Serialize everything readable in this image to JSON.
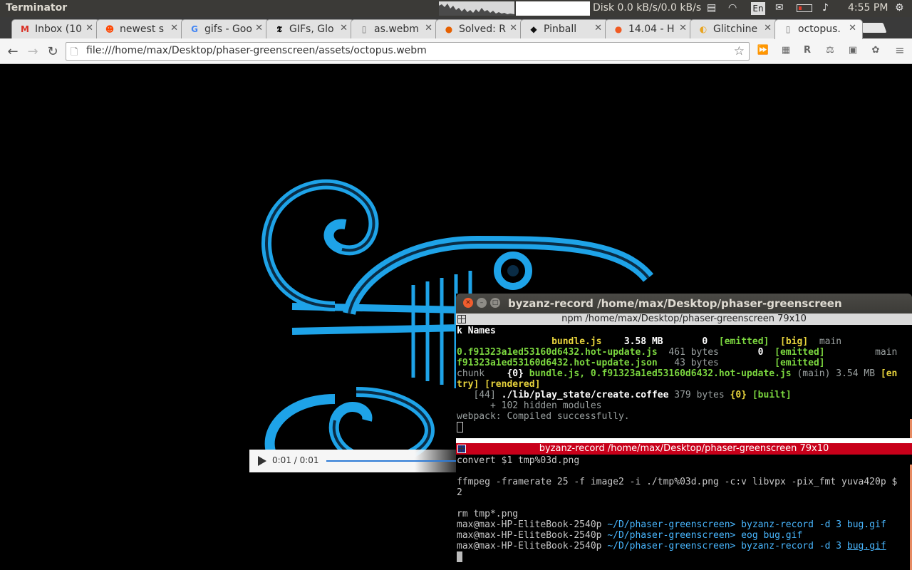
{
  "panel": {
    "app_name": "Terminator",
    "disk_label": "Disk 0.0 kB/s/0.0 kB/s",
    "lang": "En",
    "clock": "4:55 PM"
  },
  "tabs": [
    {
      "favicon": "M",
      "title": "Inbox (10",
      "color": "#d93025"
    },
    {
      "favicon": "☻",
      "title": "newest s",
      "color": "#ff4500"
    },
    {
      "favicon": "G",
      "title": "gifs - Goo",
      "color": "#4285f4"
    },
    {
      "favicon": "𝕿",
      "title": "GIFs, Glo",
      "color": "#000000"
    },
    {
      "favicon": "▯",
      "title": "as.webm",
      "color": "#777777"
    },
    {
      "favicon": "●",
      "title": "Solved: R",
      "color": "#e66000"
    },
    {
      "favicon": "◆",
      "title": "Pinball",
      "color": "#111111"
    },
    {
      "favicon": "●",
      "title": "14.04 - H",
      "color": "#f05a22"
    },
    {
      "favicon": "◐",
      "title": "Glitchine",
      "color": "#e8a31e"
    },
    {
      "favicon": "▯",
      "title": "octopus.",
      "color": "#777777"
    }
  ],
  "navbar": {
    "url": "file:///home/max/Desktop/phaser-greenscreen/assets/octopus.webm"
  },
  "video": {
    "time": "0:01 / 0:01",
    "progress": 1.0
  },
  "terminal": {
    "window_title": "byzanz-record  /home/max/Desktop/phaser-greenscreen",
    "top_pane_title": "npm  /home/max/Desktop/phaser-greenscreen 79x10",
    "bottom_pane_title": "byzanz-record  /home/max/Desktop/phaser-greenscreen 79x10",
    "top_lines": {
      "l0": "k Names",
      "l1_file": "bundle.js",
      "l1_size": "3.58 MB",
      "l1_chunk": "0",
      "l1_status": "[emitted]",
      "l1_flag": "[big]",
      "l1_name": "main",
      "l2_file": "0.f91323a1ed53160d6432.hot-update.js",
      "l2_size": "461 bytes",
      "l2_chunk": "0",
      "l2_status": "[emitted]",
      "l2_name": "main",
      "l3_file": "f91323a1ed53160d6432.hot-update.json",
      "l3_size": "43 bytes",
      "l3_status": "[emitted]",
      "l4_a": "chunk",
      "l4_b": "{0}",
      "l4_c": "bundle.js, 0.f91323a1ed53160d6432.hot-update.js",
      "l4_d": "(main)",
      "l4_e": "3.54 MB",
      "l4_f": "[en",
      "l5": "try] [rendered]",
      "l6_a": "[44]",
      "l6_b": "./lib/play_state/create.coffee",
      "l6_c": "379 bytes",
      "l6_d": "{0}",
      "l6_e": "[built]",
      "l7": "+ 102 hidden modules",
      "l8": "webpack: Compiled successfully."
    },
    "bottom_lines": {
      "l0": "convert $1 tmp%03d.png",
      "l2": "ffmpeg -framerate 25 -f image2 -i ./tmp%03d.png -c:v libvpx -pix_fmt yuva420p $",
      "l3": "2",
      "l5": "rm tmp*.png",
      "prompt_host": "max@max-HP-EliteBook-2540p",
      "prompt_path": "~/D/phaser-greenscreen>",
      "cmd1": "byzanz-record -d 3 bug.gif",
      "cmd2_a": "eog",
      "cmd2_b": "bug.gif",
      "cmd3_a": "byzanz-record -d 3",
      "cmd3_b": "bug.gif"
    }
  }
}
